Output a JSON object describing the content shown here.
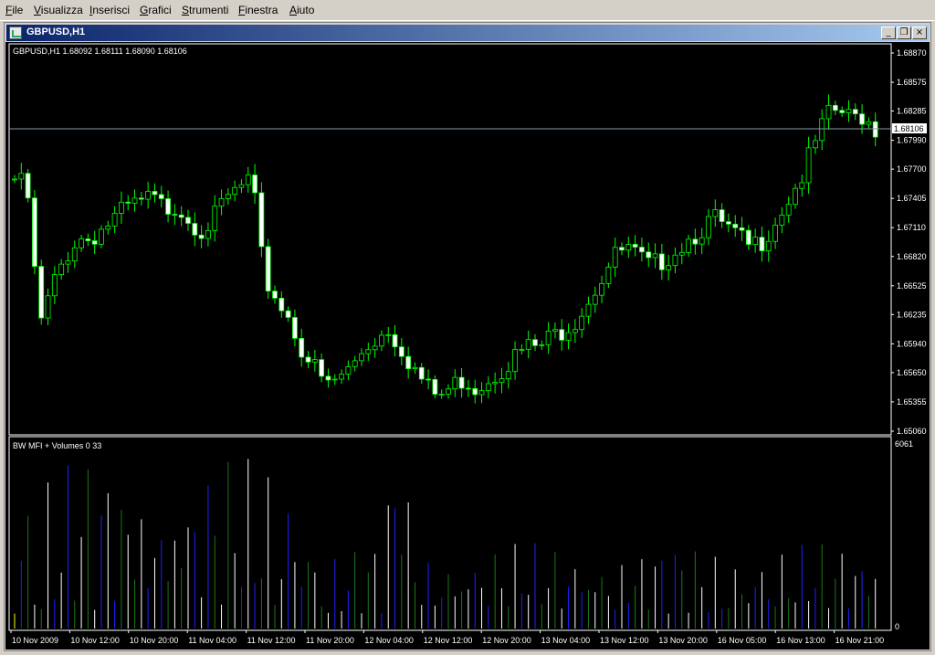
{
  "menu": [
    "File",
    "Visualizza",
    "Inserisci",
    "Grafici",
    "Strumenti",
    "Finestra",
    "Aiuto"
  ],
  "window": {
    "title": "GBPUSD,H1",
    "buttons": {
      "minimize": "_",
      "restore": "❐",
      "close": "×"
    }
  },
  "main_chart": {
    "header": "GBPUSD,H1  1.68092 1.68111 1.68090 1.68106",
    "price_labels": [
      "1.68870",
      "1.68575",
      "1.68285",
      "1.67990",
      "1.67700",
      "1.67405",
      "1.67110",
      "1.66820",
      "1.66525",
      "1.66235",
      "1.65940",
      "1.65650",
      "1.65355",
      "1.65060"
    ],
    "current_price": "1.68106",
    "y_range": [
      1.6506,
      1.6887
    ]
  },
  "indicator": {
    "header": "BW MFI + Volumes 0 33",
    "max_label": "6061",
    "zero_label": "0",
    "y_range": [
      0,
      6061
    ]
  },
  "time_labels": [
    "10 Nov 2009",
    "10 Nov 12:00",
    "10 Nov 20:00",
    "11 Nov 04:00",
    "11 Nov 12:00",
    "11 Nov 20:00",
    "12 Nov 04:00",
    "12 Nov 12:00",
    "12 Nov 20:00",
    "13 Nov 04:00",
    "13 Nov 12:00",
    "13 Nov 20:00",
    "16 Nov 05:00",
    "16 Nov 13:00",
    "16 Nov 21:00"
  ],
  "colors": {
    "background": "#000000",
    "candle": "#ffffff",
    "candle_outline": "#00ff00",
    "axis_text": "#ffffff",
    "vol_white": "#ffffff",
    "vol_blue": "#2020ff",
    "vol_green": "#1a7a1a",
    "vol_yellow": "#ffff00",
    "price_line": "#8a9aa8"
  },
  "chart_data": {
    "type": "candlestick",
    "symbol": "GBPUSD",
    "timeframe": "H1",
    "ohlc_close_path": [
      1.676,
      1.675,
      1.661,
      1.665,
      1.668,
      1.67,
      1.67,
      1.671,
      1.672,
      1.673,
      1.6735,
      1.674,
      1.673,
      1.6735,
      1.672,
      1.671,
      1.672,
      1.674,
      1.675,
      1.676,
      1.666,
      1.664,
      1.662,
      1.659,
      1.657,
      1.655,
      1.656,
      1.657,
      1.659,
      1.66,
      1.661,
      1.659,
      1.657,
      1.655,
      1.654,
      1.655,
      1.656,
      1.655,
      1.656,
      1.657,
      1.658,
      1.659,
      1.659,
      1.66,
      1.661,
      1.662,
      1.664,
      1.666,
      1.668,
      1.669,
      1.668,
      1.667,
      1.668,
      1.669,
      1.67,
      1.671,
      1.672,
      1.671,
      1.67,
      1.669,
      1.67,
      1.672,
      1.674,
      1.676,
      1.679,
      1.682,
      1.683,
      1.682,
      1.6825,
      1.6811
    ],
    "volume_series": {
      "max": 6061,
      "label": "BW MFI + Volumes"
    }
  }
}
